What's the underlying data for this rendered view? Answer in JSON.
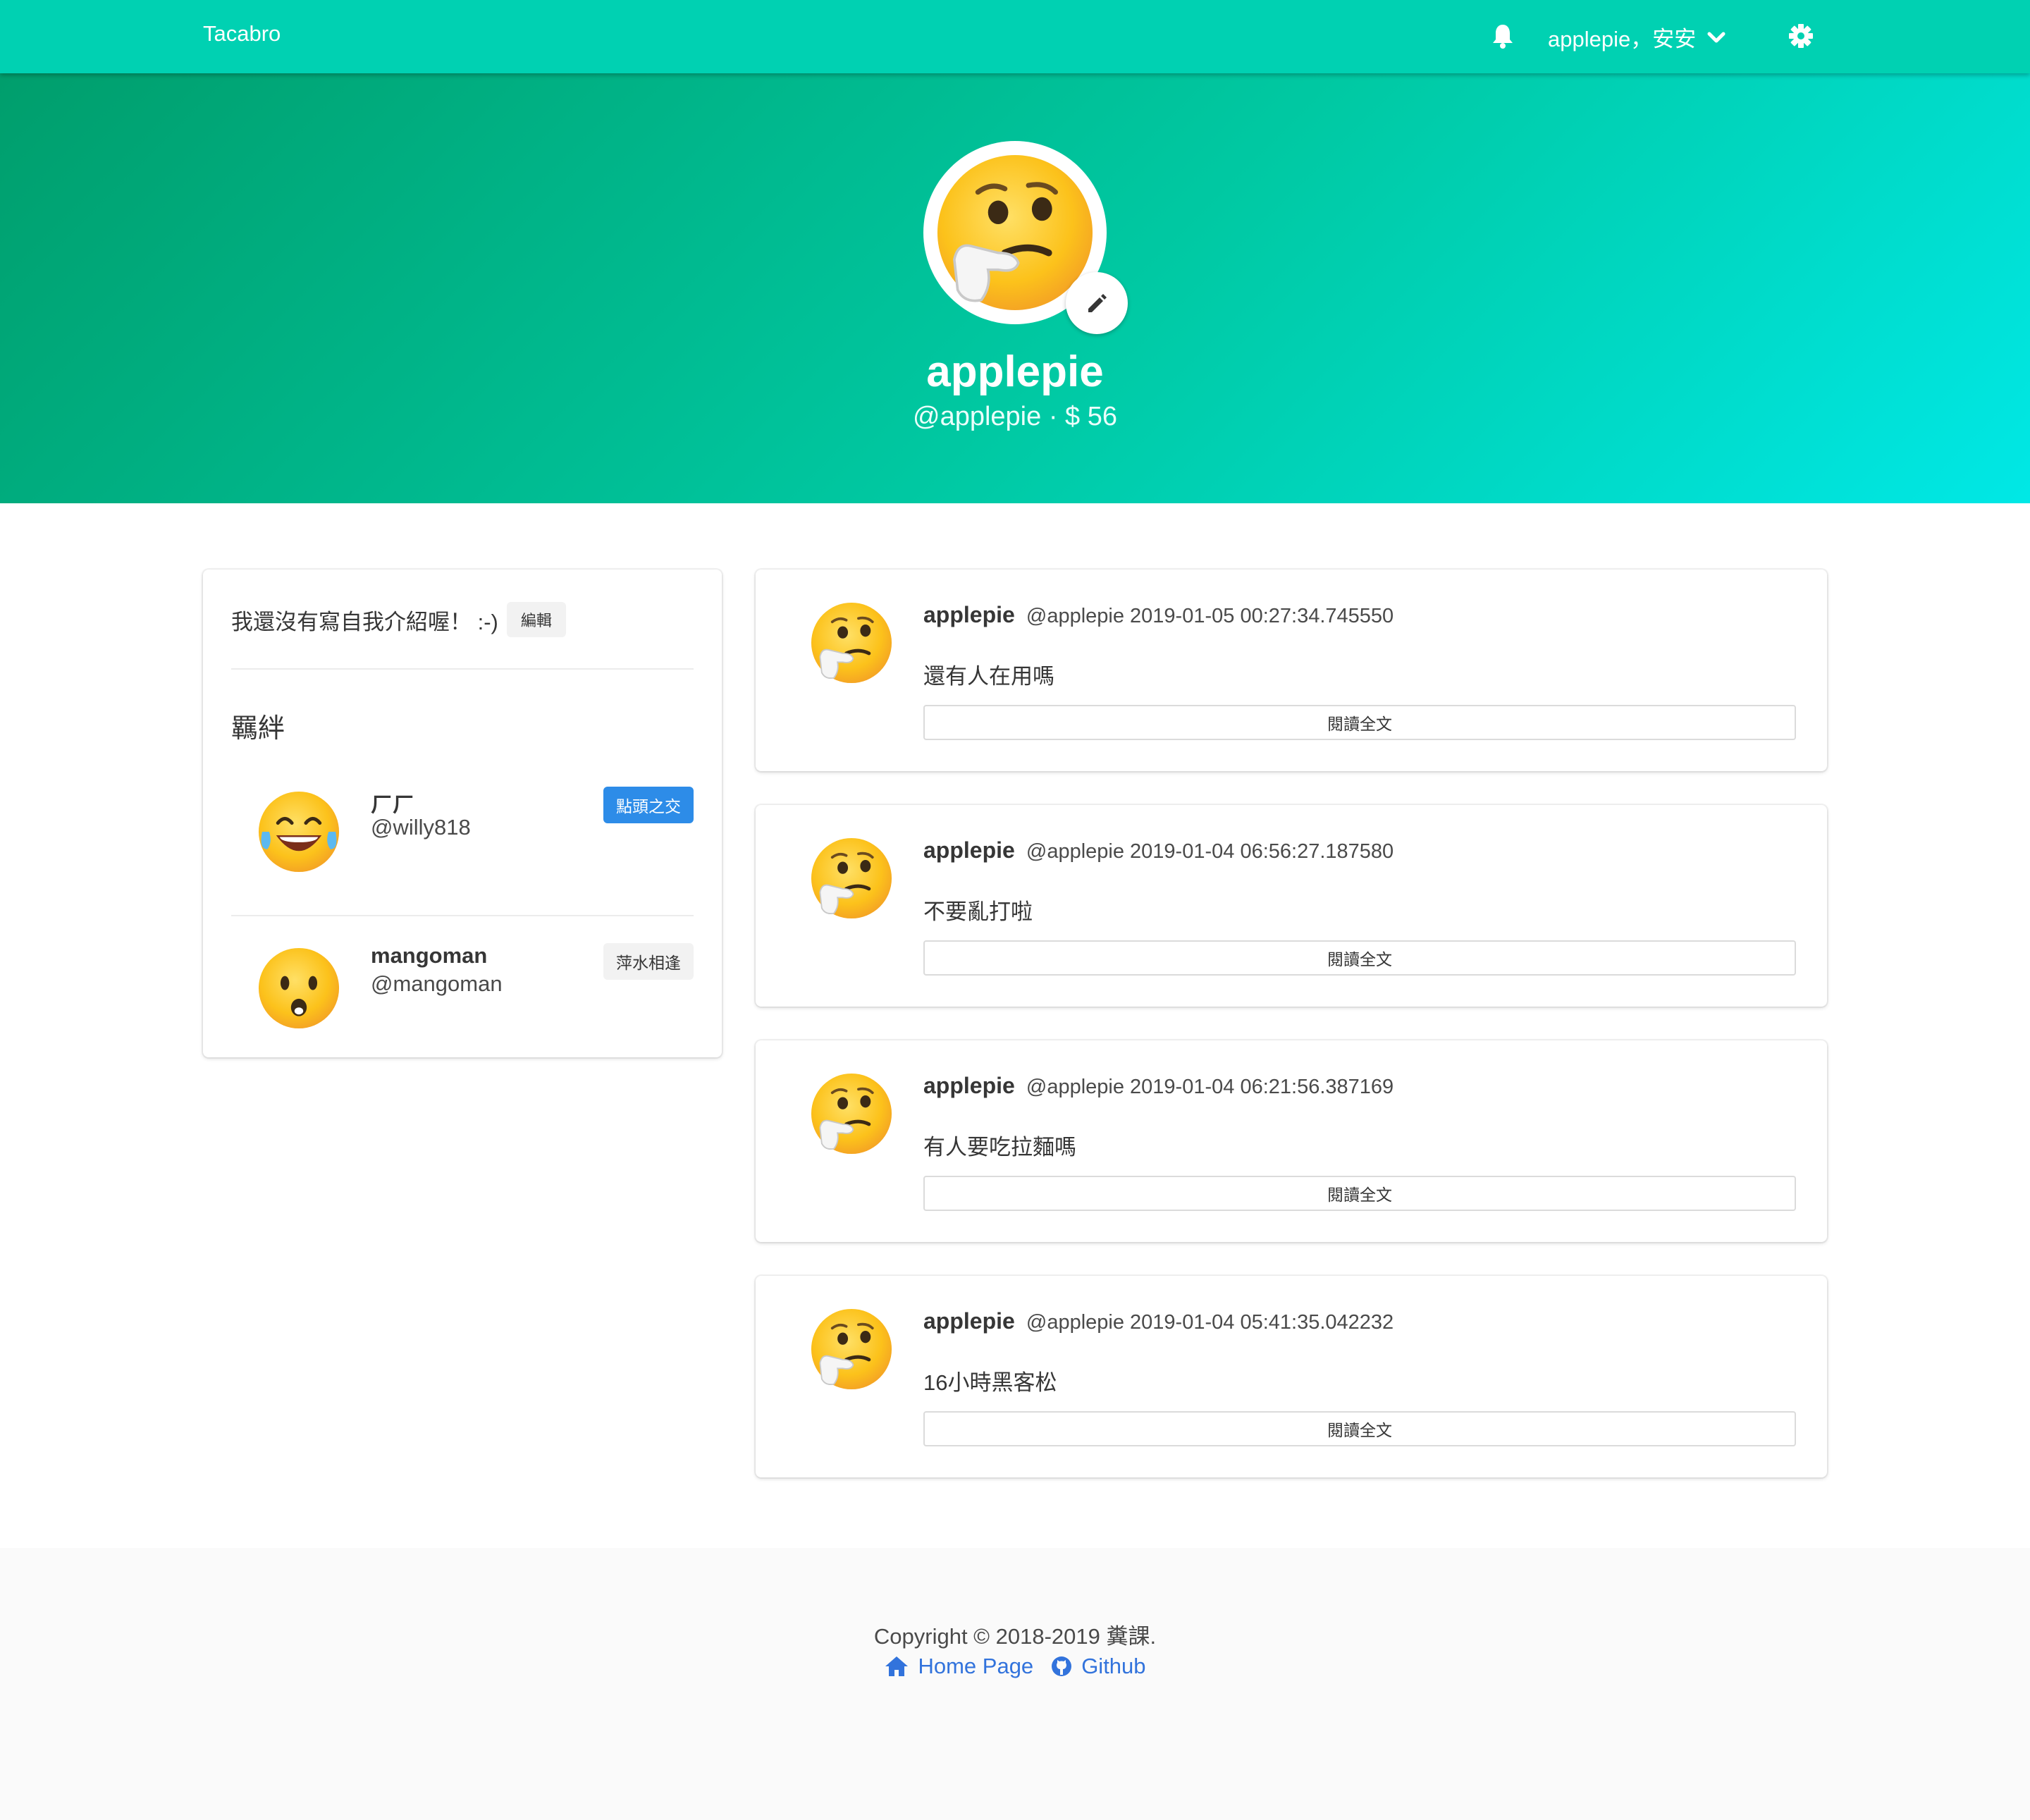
{
  "navbar": {
    "brand": "Tacabro",
    "user_greeting": "applepie，安安",
    "icons": [
      "bell-icon",
      "chevron-down-icon",
      "gear-icon"
    ]
  },
  "hero": {
    "name": "applepie",
    "subtitle": "@applepie · $ 56",
    "edit_icon": "pencil-icon"
  },
  "profile": {
    "intro": "我還沒有寫自我介紹喔！ :-)",
    "intro_edit": "編輯",
    "bonds_title": "羈絆",
    "friends": [
      {
        "name": "ㄏㄏ",
        "handle": "@willy818",
        "tag": "點頭之交",
        "tag_color": "#2d8ce8"
      },
      {
        "name": "mangoman",
        "handle": "@mangoman",
        "tag": "萍水相逢",
        "tag_color": "#f2f2f2"
      }
    ]
  },
  "posts": [
    {
      "author": "applepie",
      "handle": "@applepie",
      "time": "2019-01-05 00:27:34.745550",
      "content": "還有人在用嗎",
      "button": "閱讀全文"
    },
    {
      "author": "applepie",
      "handle": "@applepie",
      "time": "2019-01-04 06:56:27.187580",
      "content": "不要亂打啦",
      "button": "閱讀全文"
    },
    {
      "author": "applepie",
      "handle": "@applepie",
      "time": "2019-01-04 06:21:56.387169",
      "content": "有人要吃拉麵嗎",
      "button": "閱讀全文"
    },
    {
      "author": "applepie",
      "handle": "@applepie",
      "time": "2019-01-04 05:41:35.042232",
      "content": "16小時黑客松",
      "button": "閱讀全文"
    }
  ],
  "footer": {
    "copyright": "Copyright © 2018-2019 糞課.",
    "home_link": "Home Page",
    "github_link": "Github"
  },
  "colors": {
    "primary": "#00d1b2",
    "link": "#3273dc",
    "tag_blue": "#2d8ce8"
  }
}
